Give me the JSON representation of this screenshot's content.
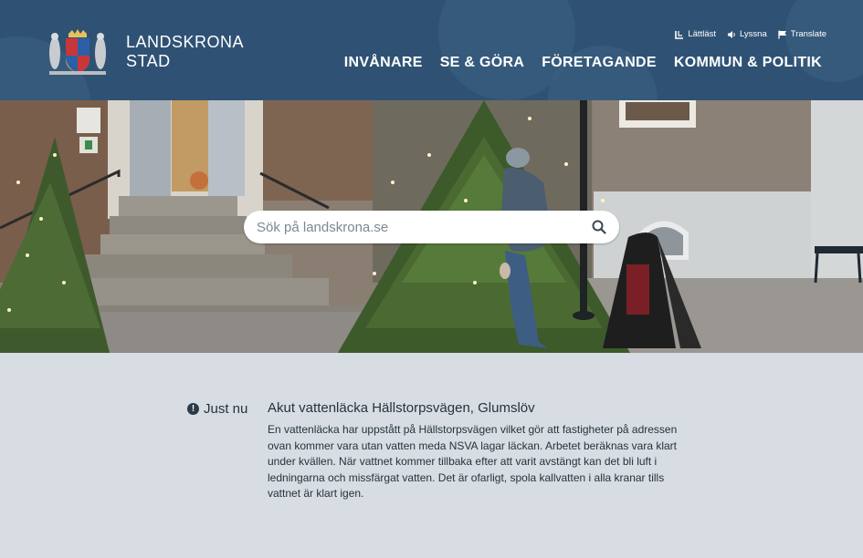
{
  "header": {
    "brand_line1": "LANDSKRONA",
    "brand_line2": "STAD",
    "utility_links": [
      {
        "label": "Lättläst",
        "icon": "easy-read-icon"
      },
      {
        "label": "Lyssna",
        "icon": "speaker-icon"
      },
      {
        "label": "Translate",
        "icon": "flag-icon"
      }
    ],
    "nav": [
      "INVÅNARE",
      "SE & GÖRA",
      "FÖRETAGANDE",
      "KOMMUN & POLITIK"
    ]
  },
  "search": {
    "placeholder": "Sök på landskrona.se",
    "icon": "search-icon"
  },
  "notice": {
    "label": "Just nu",
    "icon": "exclamation-circle-icon",
    "title": "Akut vattenläcka Hällstorpsvägen, Glumslöv",
    "body": "En vattenläcka har uppstått på Hällstorpsvägen vilket gör att fastigheter på adressen ovan kommer vara utan vatten meda NSVA lagar läckan. Arbetet beräknas vara klart under kvällen. När vattnet kommer tillbaka efter att varit avstängt kan det bli luft i ledningarna och missfärgat vatten. Det är ofarligt, spola kallvatten i alla kranar tills vattnet är klart igen."
  },
  "colors": {
    "header_bg": "#2f5274",
    "page_bg": "#d7dde2",
    "text": "#26323d"
  }
}
